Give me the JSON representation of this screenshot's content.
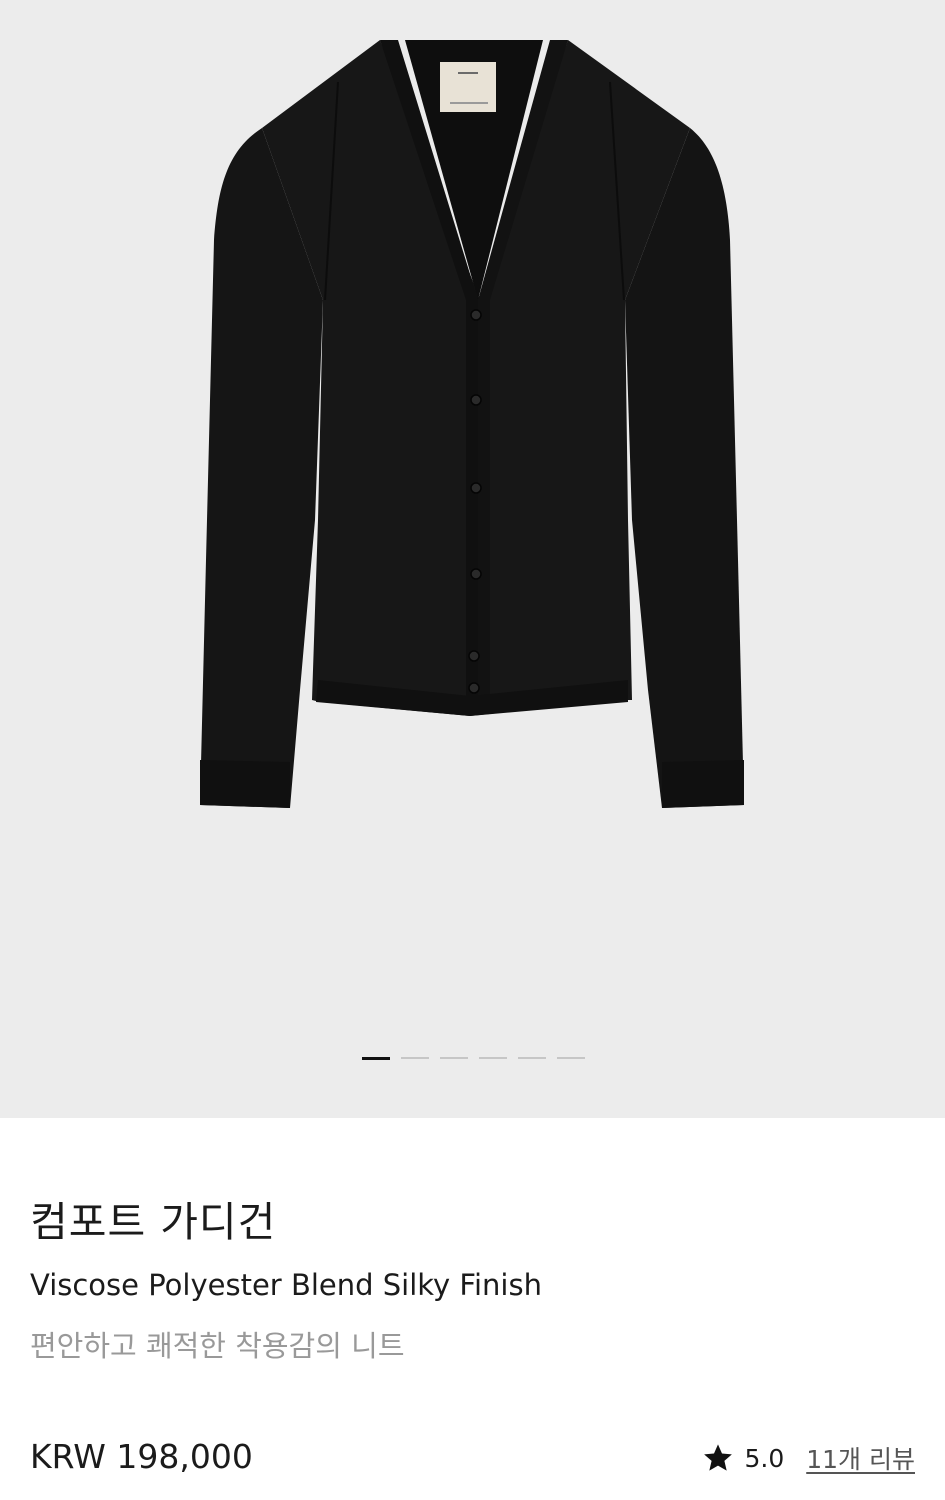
{
  "product": {
    "title_ko": "컴포트 가디건",
    "subtitle_en": "Viscose Polyester Blend Silky Finish",
    "description_ko": "편안하고 쾌적한 착용감의 니트",
    "price": "KRW 198,000",
    "rating": "5.0",
    "review_link": "11개 리뷰",
    "image_icon": "black-cardigan-photo",
    "rating_icon": "star-icon"
  },
  "gallery": {
    "total_slides": 6,
    "active_slide": 1,
    "background_color": "#ececec"
  },
  "colors": {
    "text_primary": "#1b1b1b",
    "text_secondary": "#999999",
    "garment": "#141414"
  }
}
